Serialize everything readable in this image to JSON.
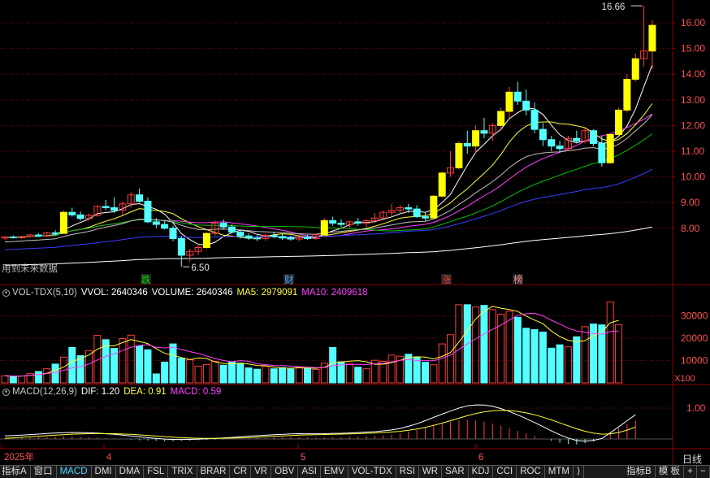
{
  "colors": {
    "up": "#ff3c3c",
    "down": "#54ffff",
    "bg": "#000000",
    "grid": "#8b0000",
    "ma5": "#ffffff",
    "ma10": "#ffff3c",
    "ma20": "#ff40ff",
    "ma30": "#00c000",
    "ma60": "#c0c0c0",
    "ma120": "#3c3cff",
    "ma250": "#ffffff"
  },
  "price_axis": {
    "labels": [
      "16.00",
      "15.00",
      "14.00",
      "13.00",
      "12.00",
      "11.00",
      "10.00",
      "9.00",
      "8.00"
    ]
  },
  "annotations": {
    "high": "16.66",
    "low": "6.50",
    "no_data": "用到未来数据"
  },
  "event_markers": [
    {
      "label": "跌",
      "color": "#00e000"
    },
    {
      "label": "财",
      "color": "#4fa8ff"
    },
    {
      "label": "涨",
      "color": "#ff4040"
    },
    {
      "label": "榜",
      "color": "#ff9090"
    }
  ],
  "volume_header": {
    "name": "VOL-TDX(5,10)",
    "vvol": "VVOL: 2640346",
    "volume": "VOLUME: 2640346",
    "ma5": "MA5: 2979091",
    "ma10": "MA10: 2409618"
  },
  "volume_axis": {
    "labels": [
      "30000",
      "20000",
      "10000"
    ],
    "unit": "X100"
  },
  "macd_header": {
    "name": "MACD(12,26,9)",
    "dif": "DIF: 1.20",
    "dea": "DEA: 0.91",
    "macd": "MACD: 0.59"
  },
  "macd_axis": {
    "labels": [
      "1.00"
    ]
  },
  "time_axis": {
    "labels": [
      "2025年",
      "4",
      "5",
      "6"
    ]
  },
  "period": "日线",
  "tabs": [
    "指标A",
    "窗口",
    "MACD",
    "DMI",
    "DMA",
    "FSL",
    "TRIX",
    "BRAR",
    "CR",
    "VR",
    "OBV",
    "ASI",
    "EMV",
    "VOL-TDX",
    "RSI",
    "WR",
    "SAR",
    "KDJ",
    "CCI",
    "ROC",
    "MTM",
    "⟩",
    "指标B",
    "模 板",
    "+",
    "−"
  ],
  "chart_data": {
    "type": "candlestick",
    "candles": [
      [
        7.62,
        7.68,
        7.55,
        7.66
      ],
      [
        7.66,
        7.72,
        7.6,
        7.63
      ],
      [
        7.63,
        7.7,
        7.58,
        7.68
      ],
      [
        7.68,
        7.78,
        7.64,
        7.74
      ],
      [
        7.74,
        7.8,
        7.66,
        7.7
      ],
      [
        7.7,
        7.86,
        7.66,
        7.82
      ],
      [
        7.82,
        7.92,
        7.74,
        7.8
      ],
      [
        7.8,
        8.7,
        7.78,
        8.62
      ],
      [
        8.62,
        8.8,
        8.45,
        8.52
      ],
      [
        8.52,
        8.65,
        8.3,
        8.38
      ],
      [
        8.38,
        8.58,
        8.3,
        8.5
      ],
      [
        8.5,
        8.9,
        8.45,
        8.85
      ],
      [
        8.85,
        9.1,
        8.7,
        8.8
      ],
      [
        8.8,
        9.2,
        8.6,
        8.7
      ],
      [
        8.7,
        9.05,
        8.5,
        8.95
      ],
      [
        8.95,
        9.4,
        8.8,
        9.3
      ],
      [
        9.3,
        9.55,
        9.0,
        9.05
      ],
      [
        9.05,
        9.2,
        8.2,
        8.25
      ],
      [
        8.25,
        8.4,
        8.0,
        8.15
      ],
      [
        8.15,
        8.3,
        7.95,
        8.0
      ],
      [
        8.0,
        8.1,
        7.5,
        7.6
      ],
      [
        7.6,
        7.7,
        6.5,
        6.95
      ],
      [
        6.95,
        7.2,
        6.7,
        7.1
      ],
      [
        7.1,
        7.4,
        6.95,
        7.25
      ],
      [
        7.25,
        7.85,
        7.2,
        7.8
      ],
      [
        7.8,
        8.3,
        7.7,
        8.2
      ],
      [
        8.2,
        8.35,
        7.95,
        8.05
      ],
      [
        8.05,
        8.15,
        7.8,
        7.85
      ],
      [
        7.85,
        7.95,
        7.6,
        7.7
      ],
      [
        7.7,
        7.8,
        7.55,
        7.62
      ],
      [
        7.62,
        7.72,
        7.5,
        7.6
      ],
      [
        7.6,
        7.78,
        7.52,
        7.72
      ],
      [
        7.72,
        7.85,
        7.62,
        7.68
      ],
      [
        7.68,
        7.76,
        7.55,
        7.62
      ],
      [
        7.62,
        7.72,
        7.52,
        7.58
      ],
      [
        7.58,
        7.7,
        7.5,
        7.65
      ],
      [
        7.65,
        7.75,
        7.55,
        7.6
      ],
      [
        7.6,
        7.8,
        7.55,
        7.75
      ],
      [
        7.75,
        8.4,
        7.7,
        8.3
      ],
      [
        8.3,
        8.45,
        8.1,
        8.2
      ],
      [
        8.2,
        8.35,
        8.05,
        8.15
      ],
      [
        8.15,
        8.3,
        8.0,
        8.25
      ],
      [
        8.25,
        8.4,
        8.1,
        8.2
      ],
      [
        8.2,
        8.35,
        8.05,
        8.3
      ],
      [
        8.3,
        8.6,
        8.2,
        8.4
      ],
      [
        8.4,
        8.7,
        8.3,
        8.62
      ],
      [
        8.62,
        8.95,
        8.5,
        8.7
      ],
      [
        8.7,
        8.9,
        8.55,
        8.8
      ],
      [
        8.8,
        8.95,
        8.6,
        8.75
      ],
      [
        8.75,
        8.9,
        8.4,
        8.45
      ],
      [
        8.45,
        8.6,
        8.3,
        8.4
      ],
      [
        8.4,
        9.3,
        8.38,
        9.25
      ],
      [
        9.25,
        10.2,
        9.2,
        10.15
      ],
      [
        10.15,
        11.0,
        10.0,
        10.35
      ],
      [
        10.35,
        11.4,
        10.3,
        11.3
      ],
      [
        11.3,
        11.8,
        10.9,
        11.2
      ],
      [
        11.2,
        12.0,
        10.95,
        11.8
      ],
      [
        11.8,
        12.3,
        11.5,
        11.7
      ],
      [
        11.7,
        12.1,
        11.4,
        12.0
      ],
      [
        12.0,
        12.7,
        11.8,
        12.55
      ],
      [
        12.55,
        13.5,
        12.3,
        13.3
      ],
      [
        13.3,
        13.7,
        12.8,
        12.95
      ],
      [
        12.95,
        13.4,
        12.4,
        12.6
      ],
      [
        12.6,
        12.9,
        11.7,
        11.85
      ],
      [
        11.85,
        12.1,
        11.2,
        11.45
      ],
      [
        11.45,
        11.6,
        11.0,
        11.2
      ],
      [
        11.2,
        11.4,
        10.95,
        11.1
      ],
      [
        11.1,
        11.6,
        11.05,
        11.5
      ],
      [
        11.5,
        11.8,
        11.3,
        11.4
      ],
      [
        11.4,
        11.9,
        11.3,
        11.8
      ],
      [
        11.8,
        11.85,
        11.2,
        11.3
      ],
      [
        11.3,
        11.6,
        10.4,
        10.55
      ],
      [
        10.55,
        11.7,
        10.5,
        11.65
      ],
      [
        11.65,
        12.7,
        11.6,
        12.6
      ],
      [
        12.6,
        14.0,
        12.5,
        13.8
      ],
      [
        13.8,
        14.8,
        13.7,
        14.6
      ],
      [
        14.6,
        16.66,
        14.3,
        14.9
      ],
      [
        14.9,
        16.1,
        14.2,
        15.9
      ]
    ],
    "volumes": [
      3200,
      2900,
      3100,
      4200,
      5100,
      6300,
      8400,
      11500,
      15800,
      12200,
      14400,
      21200,
      19300,
      15400,
      19800,
      21300,
      16500,
      14800,
      4000,
      9300,
      17400,
      11000,
      10300,
      7500,
      8200,
      9600,
      7900,
      9300,
      8800,
      6700,
      6100,
      7400,
      6300,
      6800,
      6200,
      7000,
      6600,
      6000,
      8800,
      15800,
      9400,
      8700,
      7000,
      6300,
      10100,
      9600,
      12400,
      11900,
      12800,
      11500,
      9200,
      8100,
      17400,
      21500,
      34900,
      34900,
      33900,
      34600,
      32700,
      30700,
      32000,
      29300,
      24400,
      23800,
      22700,
      15500,
      17000,
      16100,
      20600,
      25100,
      26300,
      25900,
      36200,
      26000
    ],
    "macd_hist": [
      0.02,
      0.03,
      0.04,
      0.05,
      0.06,
      0.07,
      0.08,
      0.08,
      0.08,
      0.07,
      0.06,
      0.05,
      0.03,
      0.02,
      0.0,
      -0.02,
      -0.04,
      -0.05,
      -0.06,
      -0.07,
      -0.07,
      -0.06,
      -0.05,
      -0.04,
      -0.03,
      -0.02,
      -0.01,
      0.0,
      0.02,
      0.03,
      0.03,
      0.04,
      0.05,
      0.05,
      0.06,
      0.06,
      0.05,
      0.05,
      0.05,
      0.06,
      0.06,
      0.07,
      0.08,
      0.09,
      0.1,
      0.12,
      0.14,
      0.18,
      0.24,
      0.3,
      0.37,
      0.44,
      0.5,
      0.55,
      0.6,
      0.62,
      0.6,
      0.56,
      0.5,
      0.42,
      0.34,
      0.26,
      0.18,
      0.1,
      0.02,
      -0.06,
      -0.12,
      -0.16,
      -0.18,
      -0.14,
      -0.08,
      0.0,
      0.2,
      0.35,
      0.48,
      0.59
    ]
  }
}
